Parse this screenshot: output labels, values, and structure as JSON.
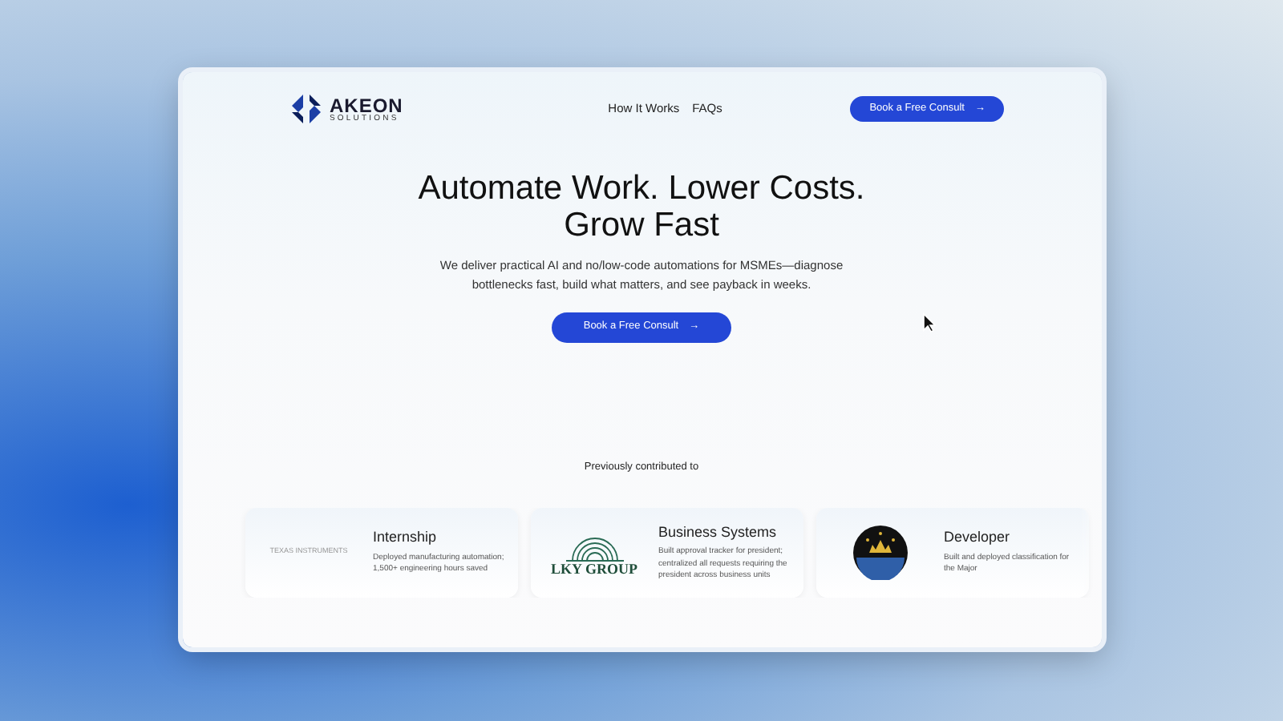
{
  "header": {
    "logo_title": "AKEON",
    "logo_subtitle": "SOLUTIONS",
    "nav_links": [
      "How It Works",
      "FAQs"
    ],
    "cta": {
      "label": "Book a Free Consult",
      "arrow": "→"
    }
  },
  "hero": {
    "title": "Automate Work. Lower Costs. Grow Fast",
    "subtitle": "We deliver practical AI and no/low-code automations for MSMEs—diagnose bottlenecks fast, build what matters, and see payback in weeks.",
    "cta": {
      "label": "Book a Free Consult",
      "arrow": "→"
    }
  },
  "partners": {
    "heading": "Previously contributed to",
    "cards": [
      {
        "kind": "wordmark",
        "logo_text": "TEXAS INSTRUMENTS",
        "title": "Internship",
        "description": "Deployed manufacturing automation; 1,500+ engineering hours saved"
      },
      {
        "kind": "emblem",
        "logo_text": "LKY GROUP",
        "title": "Business Systems",
        "description": "Built approval tracker for president; centralized all requests requiring the president across business units"
      },
      {
        "kind": "seal",
        "title": "Developer",
        "description": "Built and deployed classification for the Major"
      }
    ]
  }
}
